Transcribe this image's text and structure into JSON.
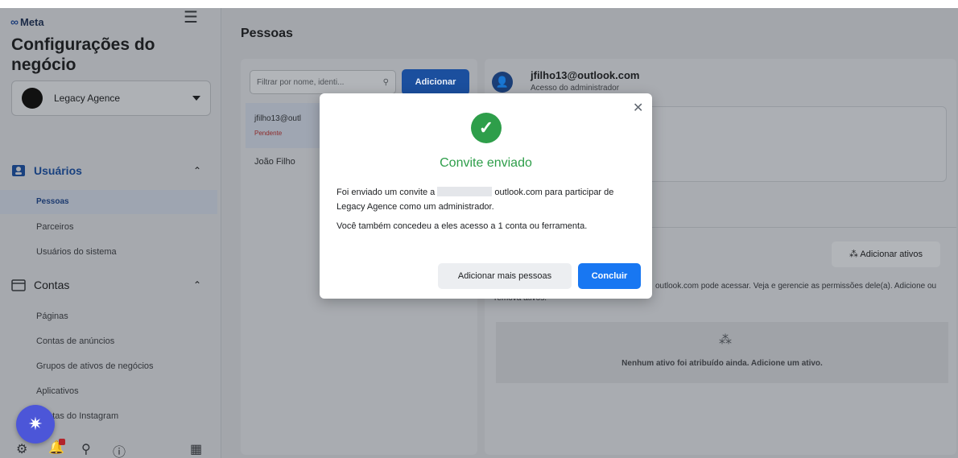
{
  "sidebar": {
    "logo": "Meta",
    "title": "Configurações do negócio",
    "account": "Legacy Agence",
    "sections": {
      "users": {
        "label": "Usuários",
        "items": [
          "Pessoas",
          "Parceiros",
          "Usuários do sistema"
        ]
      },
      "accounts": {
        "label": "Contas",
        "items": [
          "Páginas",
          "Contas de anúncios",
          "Grupos de ativos de negócios",
          "Aplicativos",
          "Contas do Instagram"
        ]
      }
    }
  },
  "main": {
    "title": "Pessoas",
    "filter_placeholder": "Filtrar por nome, identi...",
    "add_label": "Adicionar",
    "list": [
      {
        "name": "jfilho13@outl",
        "status": "Pendente"
      },
      {
        "name": "João Filho"
      }
    ],
    "detail": {
      "email": "jfilho13@outlook.com",
      "role": "Acesso do administrador",
      "add_assets": "Adicionar ativos",
      "assets_desc_part": "outlook.com pode acessar. Veja e gerencie as permissões dele(a). Adicione ou remova ativos.",
      "empty_text": "Nenhum ativo foi atribuído ainda. Adicione um ativo."
    }
  },
  "modal": {
    "title": "Convite enviado",
    "line1_start": "Foi enviado um convite a",
    "line1_end": "outlook.com para participar de Legacy Agence como um administrador.",
    "line2": "Você também concedeu a eles acesso a 1 conta ou ferramenta.",
    "btn_more": "Adicionar mais pessoas",
    "btn_done": "Concluir"
  },
  "icons": {
    "close": "close-icon",
    "check": "checkmark-icon",
    "search": "search-icon"
  }
}
